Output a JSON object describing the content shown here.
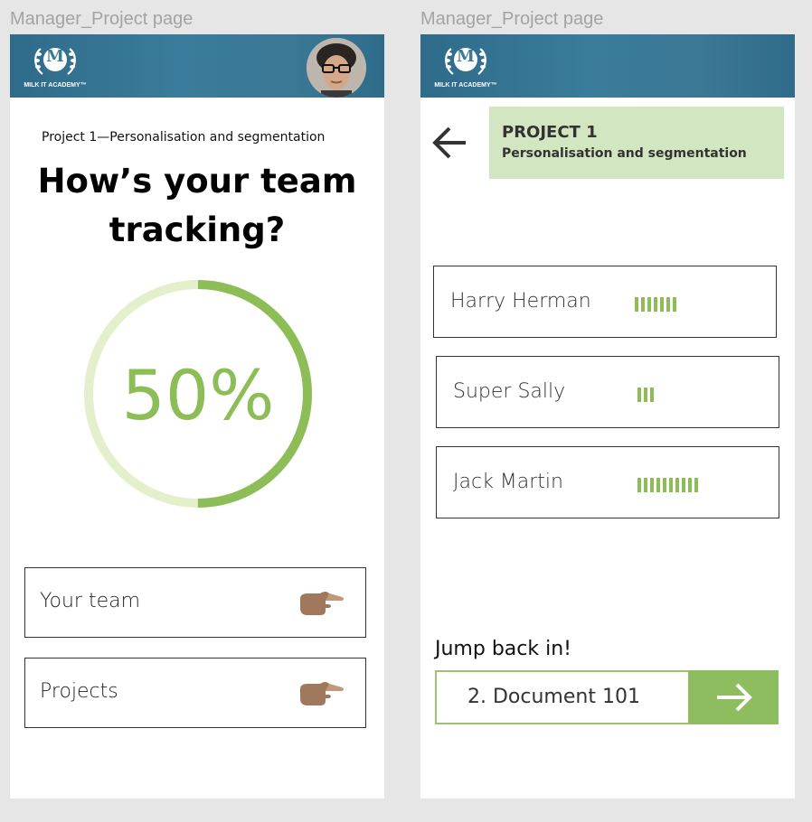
{
  "frames": [
    {
      "label": "Manager_Project page"
    },
    {
      "label": "Manager_Project page"
    }
  ],
  "header": {
    "logo_letter": "M",
    "logo_text": "MILK IT ACADEMY™",
    "avatar_icon": "user-avatar"
  },
  "overview": {
    "project_line": "Project 1—Personalisation and segmentation",
    "headline_line1": "How’s your team",
    "headline_line2": "tracking?",
    "progress_percent": 50,
    "progress_label": "50%",
    "menu": [
      {
        "label": "Your team",
        "icon": "pointing-hand-icon"
      },
      {
        "label": "Projects",
        "icon": "pointing-hand-icon"
      }
    ]
  },
  "detail": {
    "project_title": "PROJECT 1",
    "project_subtitle": "Personalisation and segmentation",
    "members": [
      {
        "name": "Harry Herman",
        "progress_ticks": 7
      },
      {
        "name": "Super Sally",
        "progress_ticks": 3
      },
      {
        "name": "Jack Martin",
        "progress_ticks": 10
      }
    ],
    "jump_back_label": "Jump back in!",
    "jump_doc": "2. Document 101"
  },
  "colors": {
    "header_blue": "#3a7c9b",
    "accent_green": "#8dbd57",
    "ring_light": "#e4f0cc",
    "banner_green": "#d3e6c2"
  }
}
